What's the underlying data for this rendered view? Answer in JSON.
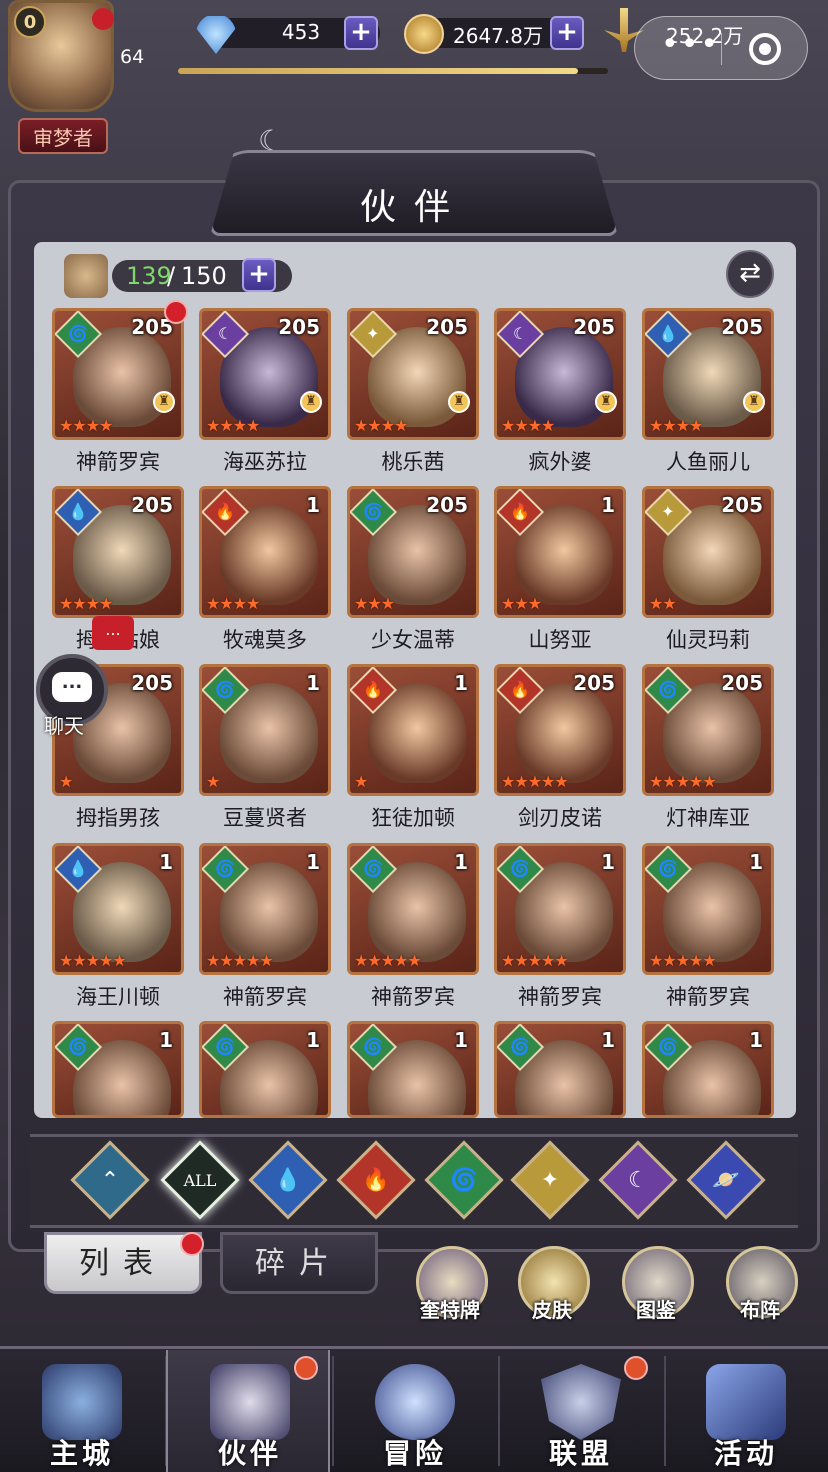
{
  "topbar": {
    "vip_level": "0",
    "player_level": "64",
    "player_title": "审梦者",
    "diamonds": "453",
    "gold": "2647.8万",
    "power": "252.2万",
    "xp_fraction": 0.93
  },
  "panel": {
    "title": "伙伴",
    "count_current": "139",
    "count_max": "150"
  },
  "heroes": [
    {
      "name": "神箭罗宾",
      "level": "205",
      "element": "wind",
      "stars": 4,
      "chess": true,
      "dot": true
    },
    {
      "name": "海巫苏拉",
      "level": "205",
      "element": "dark",
      "stars": 4,
      "chess": true
    },
    {
      "name": "桃乐茜",
      "level": "205",
      "element": "light",
      "stars": 4,
      "chess": true
    },
    {
      "name": "疯外婆",
      "level": "205",
      "element": "dark",
      "stars": 4,
      "chess": true
    },
    {
      "name": "人鱼丽儿",
      "level": "205",
      "element": "water",
      "stars": 4,
      "chess": true
    },
    {
      "name": "拇指姑娘",
      "level": "205",
      "element": "water",
      "stars": 4
    },
    {
      "name": "牧魂莫多",
      "level": "1",
      "element": "fire",
      "stars": 4
    },
    {
      "name": "少女温蒂",
      "level": "205",
      "element": "wind",
      "stars": 3
    },
    {
      "name": "山努亚",
      "level": "1",
      "element": "fire",
      "stars": 3
    },
    {
      "name": "仙灵玛莉",
      "level": "205",
      "element": "light",
      "stars": 2
    },
    {
      "name": "拇指男孩",
      "level": "205",
      "element": "wind",
      "stars": 1
    },
    {
      "name": "豆蔓贤者",
      "level": "1",
      "element": "wind",
      "stars": 1
    },
    {
      "name": "狂徒加顿",
      "level": "1",
      "element": "fire",
      "stars": 1
    },
    {
      "name": "剑刃皮诺",
      "level": "205",
      "element": "fire",
      "stars": 5
    },
    {
      "name": "灯神库亚",
      "level": "205",
      "element": "wind",
      "stars": 5
    },
    {
      "name": "海王川顿",
      "level": "1",
      "element": "water",
      "stars": 5
    },
    {
      "name": "神箭罗宾",
      "level": "1",
      "element": "wind",
      "stars": 5
    },
    {
      "name": "神箭罗宾",
      "level": "1",
      "element": "wind",
      "stars": 5
    },
    {
      "name": "神箭罗宾",
      "level": "1",
      "element": "wind",
      "stars": 5
    },
    {
      "name": "神箭罗宾",
      "level": "1",
      "element": "wind",
      "stars": 5
    },
    {
      "name": "",
      "level": "1",
      "element": "wind",
      "stars": 0
    },
    {
      "name": "",
      "level": "1",
      "element": "wind",
      "stars": 0
    },
    {
      "name": "",
      "level": "1",
      "element": "wind",
      "stars": 0
    },
    {
      "name": "",
      "level": "1",
      "element": "wind",
      "stars": 0
    },
    {
      "name": "",
      "level": "1",
      "element": "wind",
      "stars": 0
    }
  ],
  "chat": {
    "label": "聊天",
    "bubble": "...",
    "popup": "..."
  },
  "filters": [
    {
      "id": "generic",
      "label": "⌃"
    },
    {
      "id": "all",
      "label": "ALL"
    },
    {
      "id": "water",
      "label": "💧"
    },
    {
      "id": "fire",
      "label": "🔥"
    },
    {
      "id": "wind",
      "label": "🌀"
    },
    {
      "id": "light",
      "label": "✦"
    },
    {
      "id": "dark",
      "label": "☾"
    },
    {
      "id": "planet",
      "label": "🪐"
    }
  ],
  "subtabs": {
    "list": "列表",
    "fragments": "碎片"
  },
  "shortcuts": [
    "奎特牌",
    "皮肤",
    "图鉴",
    "布阵"
  ],
  "nav": [
    "主城",
    "伙伴",
    "冒险",
    "联盟",
    "活动"
  ],
  "colors": {
    "wind": "#2f8a4a",
    "fire": "#b3352a",
    "water": "#2f5fb3",
    "light": "#b89a3a",
    "dark": "#6a3fa0",
    "star": "#ff6a2a"
  }
}
